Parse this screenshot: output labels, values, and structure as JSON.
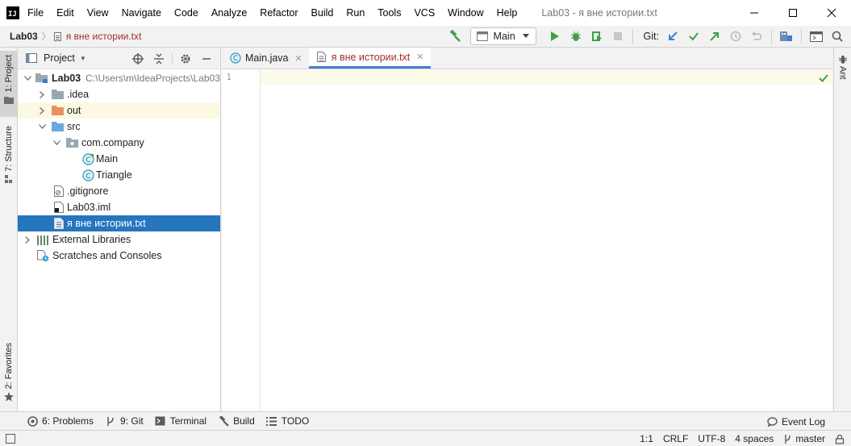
{
  "window": {
    "title": "Lab03 - я вне истории.txt",
    "menu": [
      "File",
      "Edit",
      "View",
      "Navigate",
      "Code",
      "Analyze",
      "Refactor",
      "Build",
      "Run",
      "Tools",
      "VCS",
      "Window",
      "Help"
    ]
  },
  "navbar": {
    "project": "Lab03",
    "file": "я вне истории.txt",
    "run_config": "Main",
    "git_label": "Git:"
  },
  "left_stripe": {
    "project": "1: Project",
    "structure": "7: Structure",
    "favorites": "2: Favorites"
  },
  "right_stripe": {
    "ant": "Ant"
  },
  "project_panel": {
    "title": "Project",
    "tree": [
      {
        "label": "Lab03",
        "path": "C:\\Users\\m\\IdeaProjects\\Lab03",
        "kind": "module",
        "depth": 0,
        "arrow": "expanded"
      },
      {
        "label": ".idea",
        "kind": "folder",
        "depth": 1,
        "arrow": "collapsed"
      },
      {
        "label": "out",
        "kind": "folder-excluded",
        "depth": 1,
        "arrow": "collapsed"
      },
      {
        "label": "src",
        "kind": "folder-source",
        "depth": 1,
        "arrow": "expanded"
      },
      {
        "label": "com.company",
        "kind": "package",
        "depth": 2,
        "arrow": "expanded"
      },
      {
        "label": "Main",
        "kind": "class",
        "depth": 3,
        "arrow": "none"
      },
      {
        "label": "Triangle",
        "kind": "class",
        "depth": 3,
        "arrow": "none"
      },
      {
        "label": ".gitignore",
        "kind": "ignore-file",
        "depth": 1,
        "arrow": "none"
      },
      {
        "label": "Lab03.iml",
        "kind": "iml-file",
        "depth": 1,
        "arrow": "none"
      },
      {
        "label": "я вне истории.txt",
        "kind": "text-file",
        "depth": 1,
        "arrow": "none",
        "selected": true
      },
      {
        "label": "External Libraries",
        "kind": "libraries",
        "depth": 0,
        "arrow": "collapsed"
      },
      {
        "label": "Scratches and Consoles",
        "kind": "scratches",
        "depth": 0,
        "arrow": "none"
      }
    ]
  },
  "editor": {
    "tabs": [
      {
        "label": "Main.java",
        "kind": "class",
        "active": false
      },
      {
        "label": "я вне истории.txt",
        "kind": "text-file",
        "active": true
      }
    ],
    "line_numbers": [
      "1"
    ]
  },
  "bottom_tools": {
    "problems": "6: Problems",
    "git": "9: Git",
    "terminal": "Terminal",
    "build": "Build",
    "todo": "TODO",
    "event_log": "Event Log"
  },
  "status": {
    "position": "1:1",
    "line_sep": "CRLF",
    "encoding": "UTF-8",
    "indent": "4 spaces",
    "branch": "master"
  },
  "colors": {
    "selection": "#2675bf",
    "modified_file": "#a0302a",
    "run_green": "#3fa046",
    "vcs_blue": "#3c7fd1",
    "excluded_folder": "#e8935b",
    "source_folder": "#6aa9d8"
  }
}
